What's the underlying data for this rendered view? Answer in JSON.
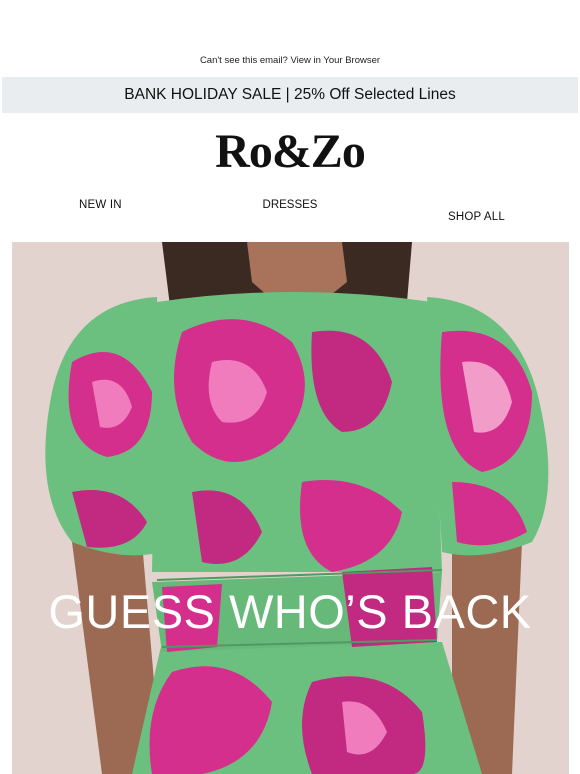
{
  "preheader": {
    "text": "Can't see this email? View in Your Browser"
  },
  "banner": {
    "text": "BANK HOLIDAY SALE | 25% Off Selected Lines"
  },
  "brand": {
    "logo": "Ro&Zo"
  },
  "nav": {
    "items": [
      "NEW IN",
      "DRESSES",
      "SHOP ALL"
    ]
  },
  "hero": {
    "headline": "GUESS WHO’S BACK",
    "image": "woman-in-floral-puff-sleeve-dress-photo"
  },
  "colors": {
    "banner_bg": "#e9edf0",
    "dress_green": "#6cc07f",
    "dress_pink": "#d42f8c",
    "background": "#e2d3ce"
  }
}
